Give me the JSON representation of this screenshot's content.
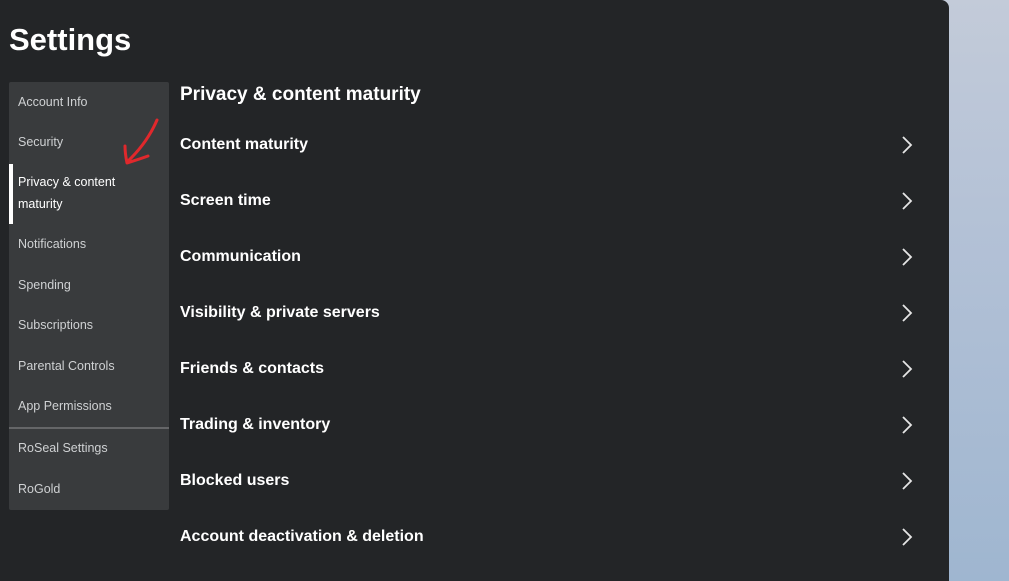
{
  "page": {
    "title": "Settings"
  },
  "sidebar": {
    "items": [
      {
        "label": "Account Info"
      },
      {
        "label": "Security"
      },
      {
        "label": "Privacy & content maturity",
        "active": true
      },
      {
        "label": "Notifications"
      },
      {
        "label": "Spending"
      },
      {
        "label": "Subscriptions"
      },
      {
        "label": "Parental Controls"
      },
      {
        "label": "App Permissions"
      },
      {
        "label": "RoSeal Settings"
      },
      {
        "label": "RoGold"
      }
    ]
  },
  "content": {
    "title": "Privacy & content maturity",
    "rows": [
      {
        "label": "Content maturity"
      },
      {
        "label": "Screen time"
      },
      {
        "label": "Communication"
      },
      {
        "label": "Visibility & private servers"
      },
      {
        "label": "Friends & contacts"
      },
      {
        "label": "Trading & inventory"
      },
      {
        "label": "Blocked users"
      },
      {
        "label": "Account deactivation & deletion"
      }
    ]
  },
  "icons": {
    "row_chevron": "chevron-right-icon",
    "annotation": "hand-drawn-arrow-icon"
  },
  "colors": {
    "panel_bg": "#232527",
    "sidebar_bg": "#393b3d",
    "text": "#ffffff",
    "annotation": "#e0282c"
  }
}
